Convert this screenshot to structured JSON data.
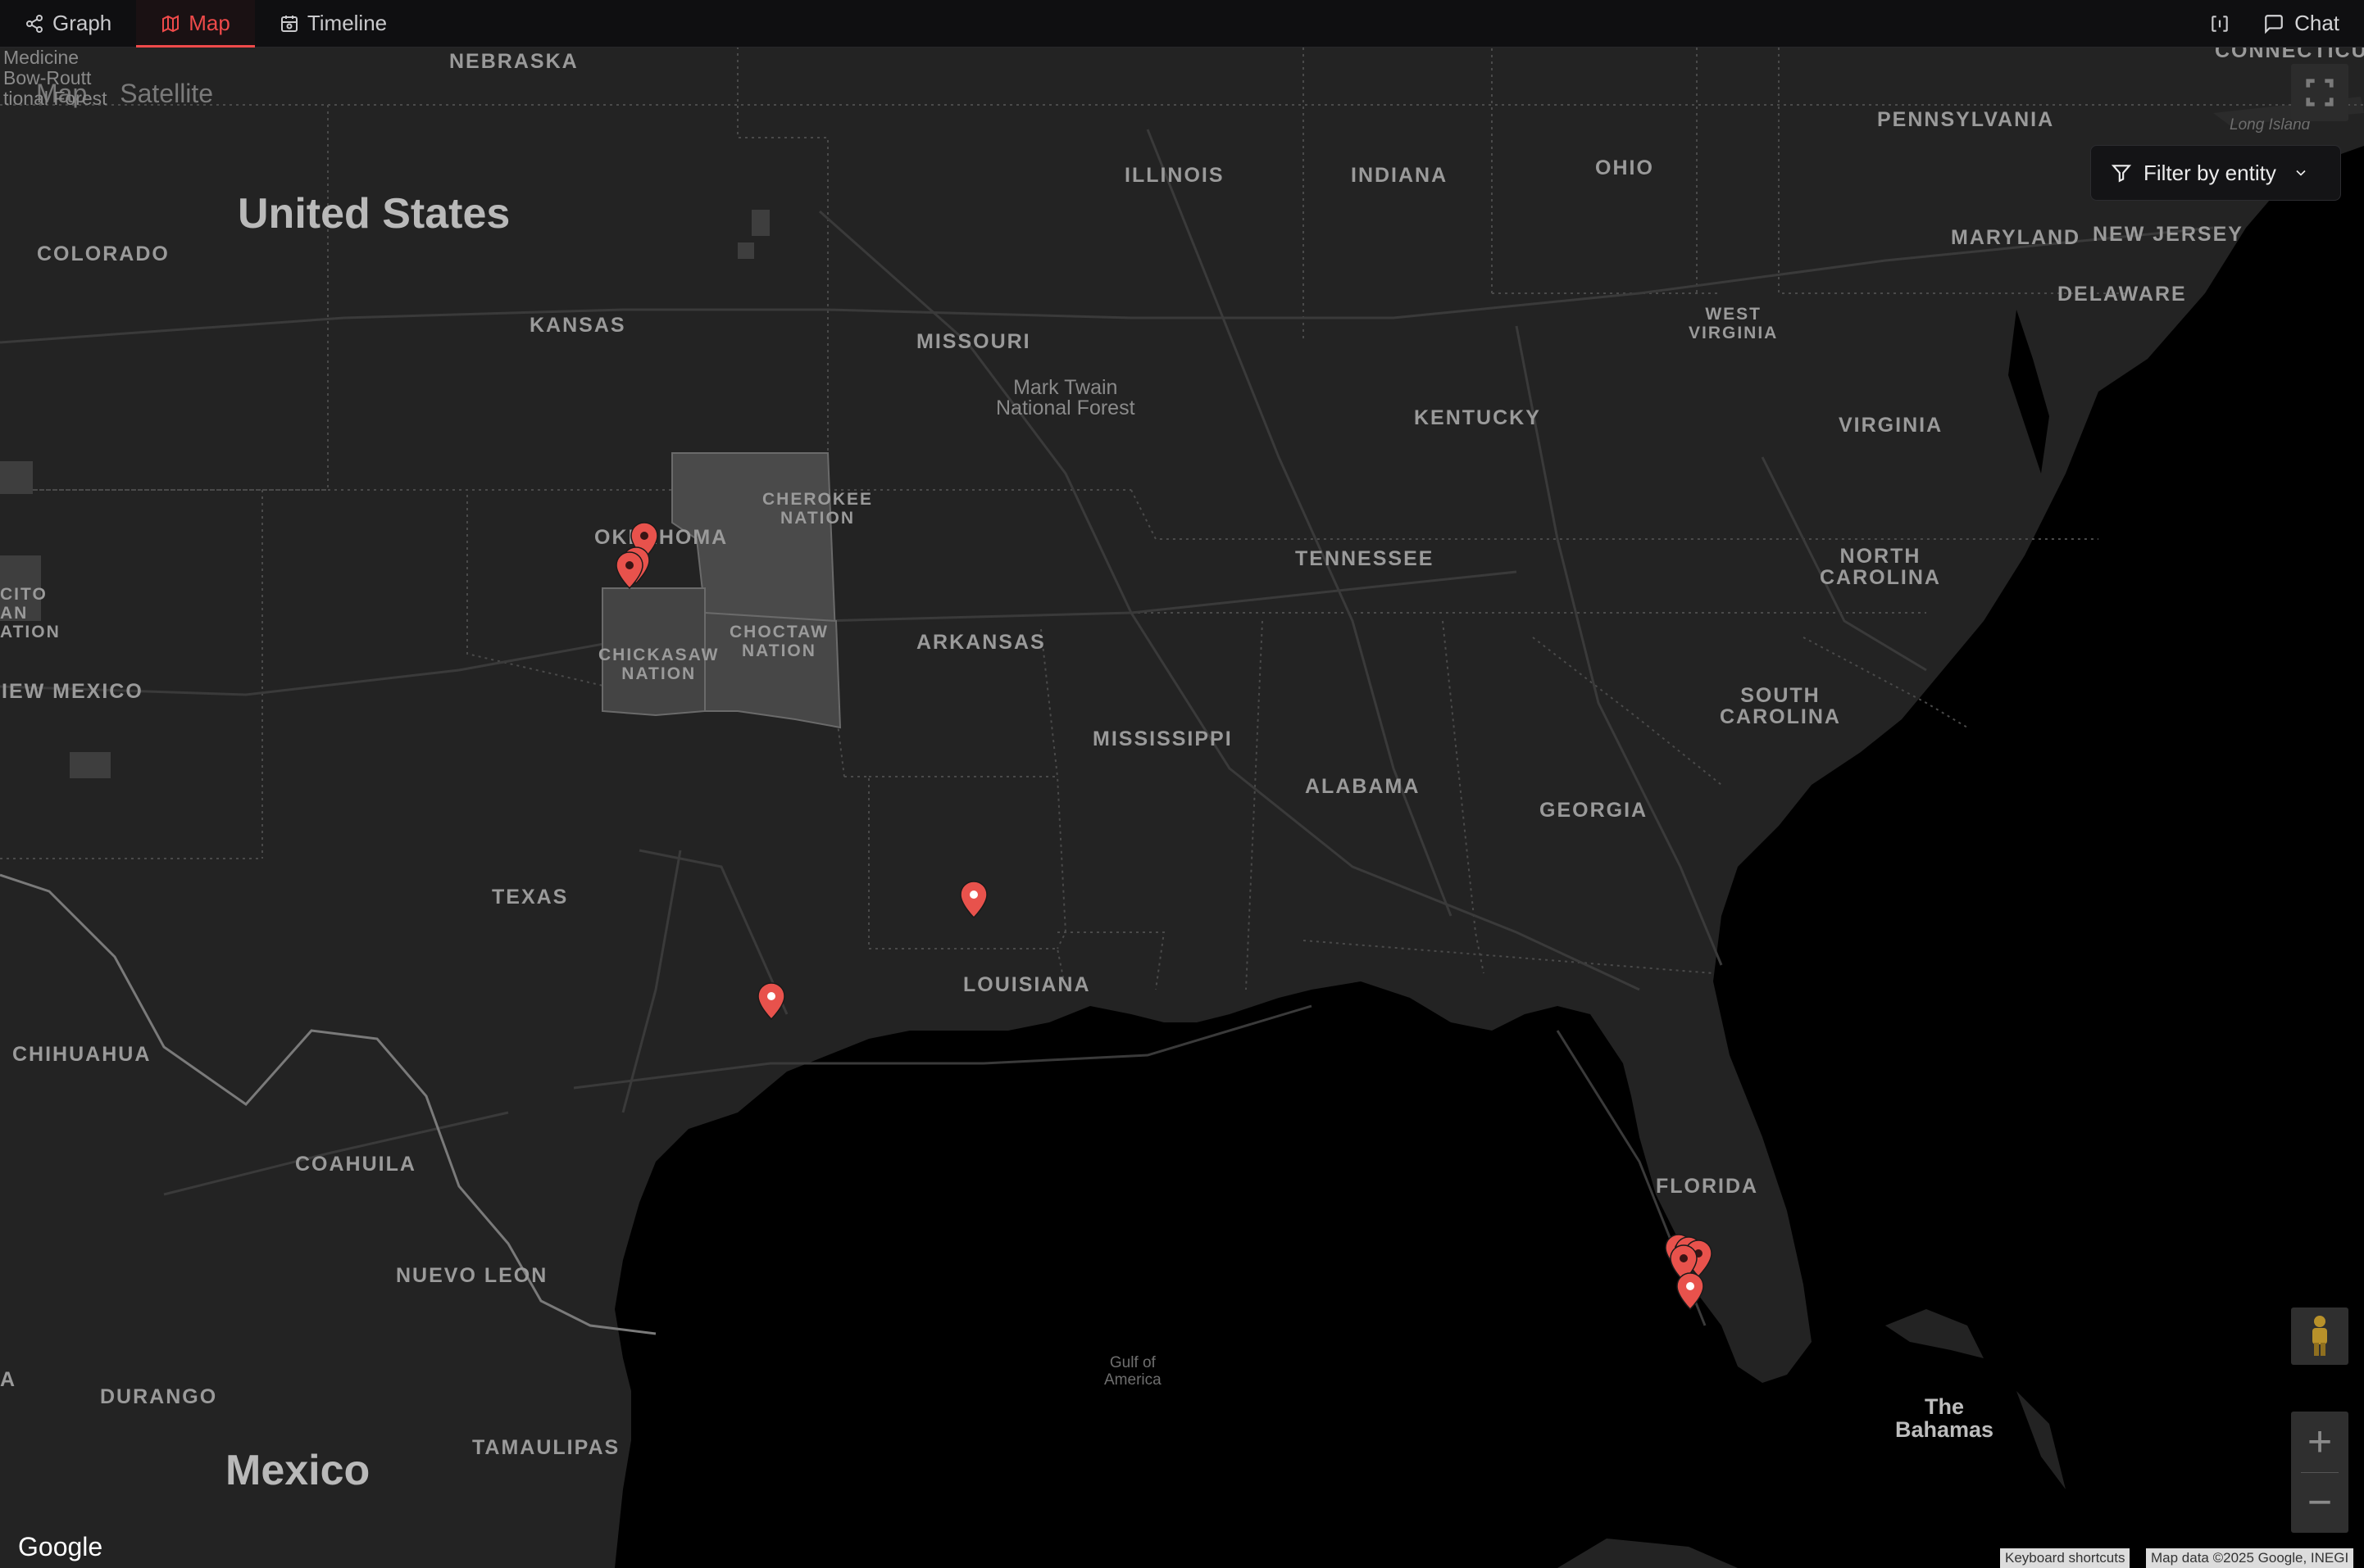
{
  "tabs": [
    {
      "label": "Graph",
      "icon": "share-graph-icon",
      "active": false
    },
    {
      "label": "Map",
      "icon": "map-icon",
      "active": true
    },
    {
      "label": "Timeline",
      "icon": "calendar-icon",
      "active": false
    }
  ],
  "header": {
    "panel_toggle_icon": "panel-toggle-icon",
    "chat_label": "Chat",
    "chat_icon": "chat-bubble-icon"
  },
  "map": {
    "type_options": [
      "Map",
      "Satellite"
    ],
    "filter_label": "Filter by entity",
    "attribution": {
      "brand": "Google",
      "shortcuts": "Keyboard shortcuts",
      "data": "Map data ©2025 Google, INEGI"
    },
    "country_labels": {
      "us": "United States",
      "mexico": "Mexico"
    },
    "state_labels": {
      "nebraska": "NEBRASKA",
      "colorado": "COLORADO",
      "kansas": "KANSAS",
      "missouri": "MISSOURI",
      "illinois": "ILLINOIS",
      "indiana": "INDIANA",
      "ohio": "OHIO",
      "pennsylvania": "PENNSYLVANIA",
      "connecticut": "CONNECTICUT",
      "maryland": "MARYLAND",
      "new_jersey": "NEW JERSEY",
      "delaware": "DELAWARE",
      "west_virginia": "WEST\nVIRGINIA",
      "kentucky": "KENTUCKY",
      "virginia": "VIRGINIA",
      "oklahoma": "OKLAHOMA",
      "tennessee": "TENNESSEE",
      "north_carolina": "NORTH\nCAROLINA",
      "arkansas": "ARKANSAS",
      "new_mexico": "IEW MEXICO",
      "mississippi": "MISSISSIPPI",
      "alabama": "ALABAMA",
      "south_carolina": "SOUTH\nCAROLINA",
      "georgia": "GEORGIA",
      "texas": "TEXAS",
      "louisiana": "LOUISIANA",
      "florida": "FLORIDA",
      "chihuahua": "CHIHUAHUA",
      "coahuila": "COAHUILA",
      "nuevo_leon": "NUEVO LEON",
      "durango": "DURANGO",
      "tamaulipas": "TAMAULIPAS"
    },
    "area_labels": {
      "cherokee": "CHEROKEE\nNATION",
      "chickasaw": "CHICKASAW\nNATION",
      "choctaw": "CHOCTAW\nNATION",
      "mark_twain": "Mark Twain\nNational Forest",
      "gulf": "Gulf of\nAmerica",
      "bahamas": "The\nBahamas",
      "long_island": "Long Island",
      "medicine_bow": "Medicine\nBow-Routt\ntional Forest",
      "cito": "CITO\nAN\nATION",
      "a": "A"
    },
    "markers": [
      {
        "name": "Oklahoma City area 1"
      },
      {
        "name": "Oklahoma City area 2"
      },
      {
        "name": "Oklahoma City area 3"
      },
      {
        "name": "Shreveport area"
      },
      {
        "name": "Beaumont area"
      },
      {
        "name": "Fort Myers area 1"
      },
      {
        "name": "Fort Myers area 2"
      },
      {
        "name": "Fort Myers area 3"
      },
      {
        "name": "Fort Myers area 4"
      },
      {
        "name": "Naples area"
      }
    ],
    "colors": {
      "accent": "#ef4a4a",
      "marker": "#e8524c",
      "land": "#232323",
      "water": "#000000"
    }
  }
}
